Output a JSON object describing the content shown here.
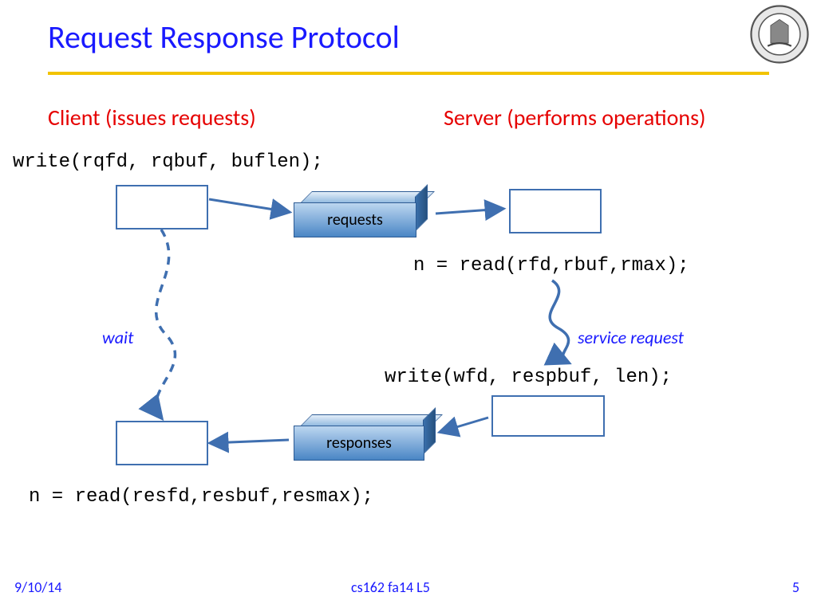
{
  "title": "Request Response Protocol",
  "headers": {
    "client": "Client (issues requests)",
    "server": "Server (performs operations)"
  },
  "code": {
    "client_write": "write(rqfd, rqbuf, buflen);",
    "server_read": "n = read(rfd,rbuf,rmax);",
    "server_write": "write(wfd, respbuf, len);",
    "client_read": "n = read(resfd,resbuf,resmax);"
  },
  "labels": {
    "requests": "requests",
    "responses": "responses",
    "wait": "wait",
    "service": "service request"
  },
  "footer": {
    "date": "9/10/14",
    "course": "cs162 fa14 L5",
    "page": "5"
  }
}
